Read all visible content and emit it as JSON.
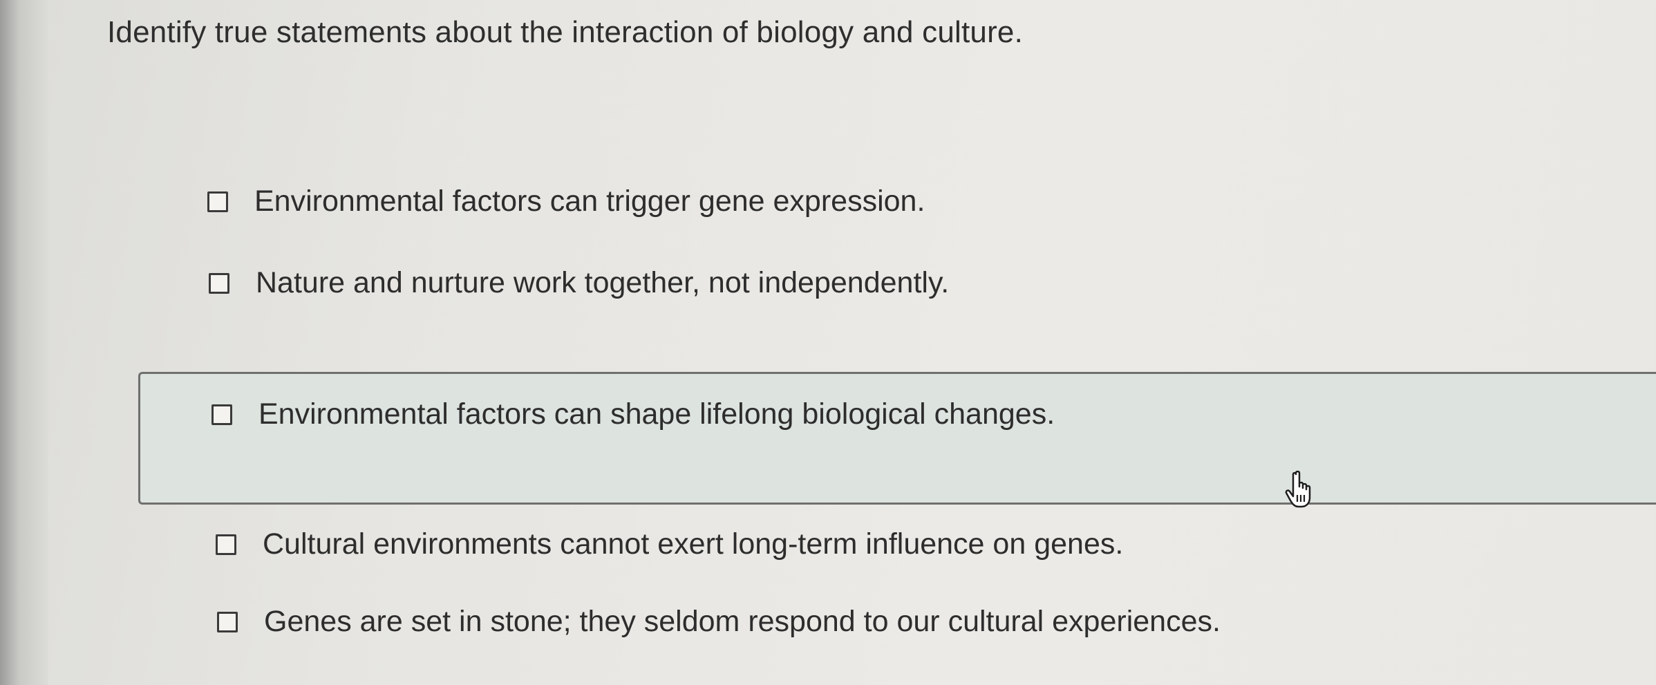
{
  "question": {
    "text": "Identify true statements about the interaction of biology and culture."
  },
  "options": [
    {
      "label": "Environmental factors can trigger gene expression.",
      "checked": false
    },
    {
      "label": "Nature and nurture work together, not independently.",
      "checked": false
    },
    {
      "label": "Environmental factors can shape lifelong biological changes.",
      "checked": false,
      "hovered": true
    },
    {
      "label": "Cultural environments cannot exert long-term influence on genes.",
      "checked": false
    },
    {
      "label": "Genes are set in stone; they seldom respond to our cultural experiences.",
      "checked": false
    }
  ],
  "cursor": {
    "icon": "hand-pointer-icon"
  },
  "colors": {
    "background": "#e8e7e3",
    "hover_band": "#dde3de",
    "text": "#2d2d2d"
  }
}
